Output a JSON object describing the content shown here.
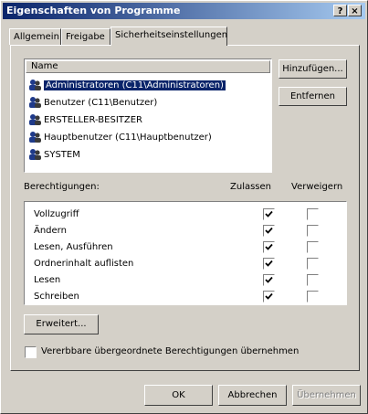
{
  "window": {
    "title": "Eigenschaften von Programme",
    "help_button": "?",
    "close_button": "×"
  },
  "tabs": [
    {
      "label": "Allgemein"
    },
    {
      "label": "Freigabe"
    },
    {
      "label": "Sicherheitseinstellungen",
      "active": true
    }
  ],
  "users": {
    "column_header": "Name",
    "items": [
      {
        "label": "Administratoren (C11\\Administratoren)",
        "selected": true,
        "icon": "user-group-icon"
      },
      {
        "label": "Benutzer (C11\\Benutzer)",
        "icon": "user-group-icon"
      },
      {
        "label": "ERSTELLER-BESITZER",
        "icon": "user-group-icon"
      },
      {
        "label": "Hauptbenutzer (C11\\Hauptbenutzer)",
        "icon": "user-group-icon"
      },
      {
        "label": "SYSTEM",
        "icon": "user-group-icon"
      }
    ],
    "add_button": "Hinzufügen...",
    "remove_button": "Entfernen"
  },
  "permissions": {
    "label": "Berechtigungen:",
    "allow_header": "Zulassen",
    "deny_header": "Verweigern",
    "rows": [
      {
        "label": "Vollzugriff",
        "allow": true,
        "deny": false
      },
      {
        "label": "Ändern",
        "allow": true,
        "deny": false
      },
      {
        "label": "Lesen, Ausführen",
        "allow": true,
        "deny": false
      },
      {
        "label": "Ordnerinhalt auflisten",
        "allow": true,
        "deny": false
      },
      {
        "label": "Lesen",
        "allow": true,
        "deny": false
      },
      {
        "label": "Schreiben",
        "allow": true,
        "deny": false
      }
    ]
  },
  "advanced_button": "Erweitert...",
  "inherit": {
    "label": "Vererbbare übergeordnete Berechtigungen übernehmen",
    "checked": false
  },
  "footer": {
    "ok": "OK",
    "cancel": "Abbrechen",
    "apply": "Übernehmen"
  }
}
